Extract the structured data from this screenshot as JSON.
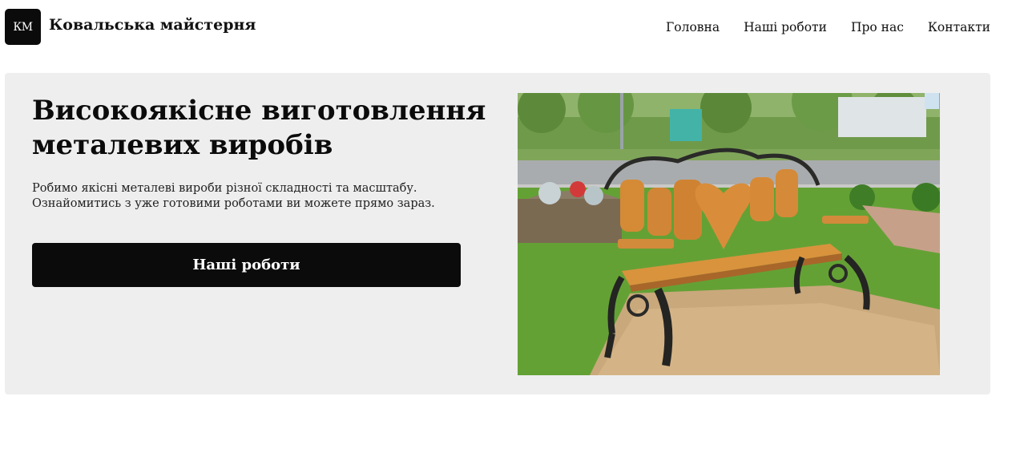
{
  "header": {
    "logo_text": "КМ",
    "brand_name": "Ковальська майстерня",
    "nav": [
      {
        "label": "Головна"
      },
      {
        "label": "Наші роботи"
      },
      {
        "label": "Про нас"
      },
      {
        "label": "Контакти"
      }
    ]
  },
  "hero": {
    "title": "Високоякісне виготовлення металевих виробів",
    "description_line1": "Робимо якісні металеві вироби різної складності та масштабу.",
    "description_line2": "Ознайомитись з уже готовими роботами ви можете прямо зараз.",
    "cta_label": "Наші роботи",
    "image": "photo of wrought-iron bench with wooden heart-shaped back slats in a park"
  },
  "colors": {
    "page_bg": "#ffffff",
    "hero_bg": "#eeeeee",
    "button_bg": "#0b0b0b",
    "text": "#111111"
  }
}
